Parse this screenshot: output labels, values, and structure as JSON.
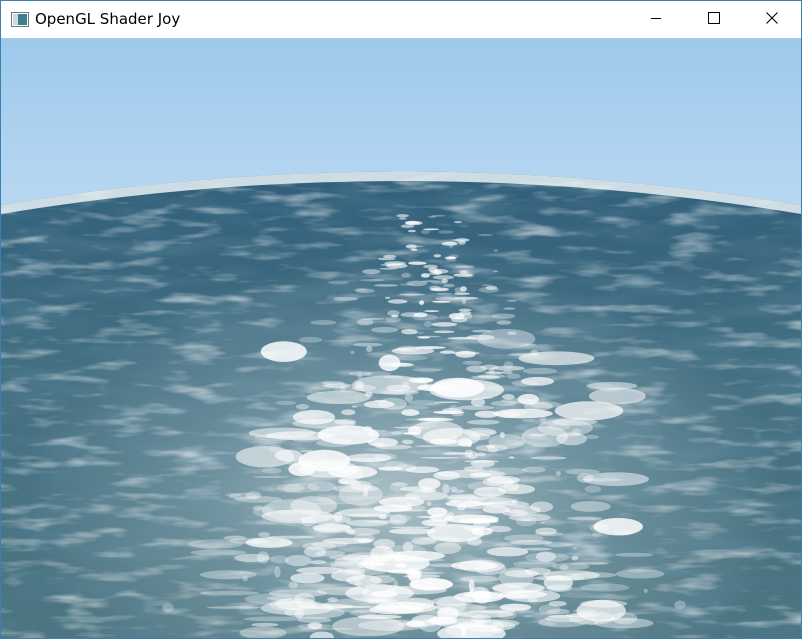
{
  "window": {
    "title": "OpenGL Shader Joy"
  },
  "icons": {
    "app": "app-window-icon",
    "minimize": "minimize-icon",
    "maximize": "maximize-icon",
    "close": "close-icon"
  },
  "scene": {
    "sky_top_color": "#9dc9ec",
    "sky_horizon_color": "#f4f9fd",
    "sea_far_color": "#2f5a77",
    "sea_mid_color": "#436f82",
    "sea_near_color": "#4c7581",
    "highlight_color": "#ffffff"
  }
}
